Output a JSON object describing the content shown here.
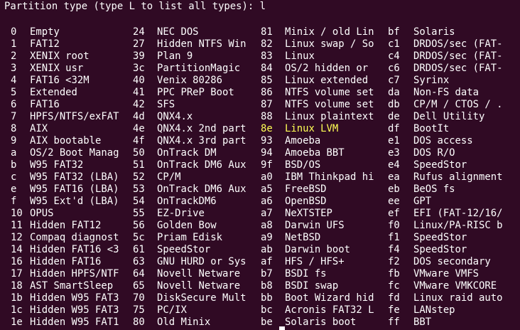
{
  "terminal": {
    "prompt": "Partition type (type L to list all types): l",
    "highlight_color": "#ffff55",
    "background_color": "#300a24",
    "text_color": "#ffffff",
    "rows": [
      [
        [
          "0",
          "Empty"
        ],
        [
          "24",
          "NEC DOS"
        ],
        [
          "81",
          "Minix / old Lin"
        ],
        [
          "bf",
          "Solaris"
        ]
      ],
      [
        [
          "1",
          "FAT12"
        ],
        [
          "27",
          "Hidden NTFS Win"
        ],
        [
          "82",
          "Linux swap / So"
        ],
        [
          "c1",
          "DRDOS/sec (FAT-"
        ]
      ],
      [
        [
          "2",
          "XENIX root"
        ],
        [
          "39",
          "Plan 9"
        ],
        [
          "83",
          "Linux"
        ],
        [
          "c4",
          "DRDOS/sec (FAT-"
        ]
      ],
      [
        [
          "3",
          "XENIX usr"
        ],
        [
          "3c",
          "PartitionMagic"
        ],
        [
          "84",
          "OS/2 hidden or"
        ],
        [
          "c6",
          "DRDOS/sec (FAT-"
        ]
      ],
      [
        [
          "4",
          "FAT16 <32M"
        ],
        [
          "40",
          "Venix 80286"
        ],
        [
          "85",
          "Linux extended"
        ],
        [
          "c7",
          "Syrinx"
        ]
      ],
      [
        [
          "5",
          "Extended"
        ],
        [
          "41",
          "PPC PReP Boot"
        ],
        [
          "86",
          "NTFS volume set"
        ],
        [
          "da",
          "Non-FS data"
        ]
      ],
      [
        [
          "6",
          "FAT16"
        ],
        [
          "42",
          "SFS"
        ],
        [
          "87",
          "NTFS volume set"
        ],
        [
          "db",
          "CP/M / CTOS / ."
        ]
      ],
      [
        [
          "7",
          "HPFS/NTFS/exFAT"
        ],
        [
          "4d",
          "QNX4.x"
        ],
        [
          "88",
          "Linux plaintext"
        ],
        [
          "de",
          "Dell Utility"
        ]
      ],
      [
        [
          "8",
          "AIX"
        ],
        [
          "4e",
          "QNX4.x 2nd part"
        ],
        [
          "8e",
          "Linux LVM"
        ],
        [
          "df",
          "BootIt"
        ]
      ],
      [
        [
          "9",
          "AIX bootable"
        ],
        [
          "4f",
          "QNX4.x 3rd part"
        ],
        [
          "93",
          "Amoeba"
        ],
        [
          "e1",
          "DOS access"
        ]
      ],
      [
        [
          "a",
          "OS/2 Boot Manag"
        ],
        [
          "50",
          "OnTrack DM"
        ],
        [
          "94",
          "Amoeba BBT"
        ],
        [
          "e3",
          "DOS R/O"
        ]
      ],
      [
        [
          "b",
          "W95 FAT32"
        ],
        [
          "51",
          "OnTrack DM6 Aux"
        ],
        [
          "9f",
          "BSD/OS"
        ],
        [
          "e4",
          "SpeedStor"
        ]
      ],
      [
        [
          "c",
          "W95 FAT32 (LBA)"
        ],
        [
          "52",
          "CP/M"
        ],
        [
          "a0",
          "IBM Thinkpad hi"
        ],
        [
          "ea",
          "Rufus alignment"
        ]
      ],
      [
        [
          "e",
          "W95 FAT16 (LBA)"
        ],
        [
          "53",
          "OnTrack DM6 Aux"
        ],
        [
          "a5",
          "FreeBSD"
        ],
        [
          "eb",
          "BeOS fs"
        ]
      ],
      [
        [
          "f",
          "W95 Ext'd (LBA)"
        ],
        [
          "54",
          "OnTrackDM6"
        ],
        [
          "a6",
          "OpenBSD"
        ],
        [
          "ee",
          "GPT"
        ]
      ],
      [
        [
          "10",
          "OPUS"
        ],
        [
          "55",
          "EZ-Drive"
        ],
        [
          "a7",
          "NeXTSTEP"
        ],
        [
          "ef",
          "EFI (FAT-12/16/"
        ]
      ],
      [
        [
          "11",
          "Hidden FAT12"
        ],
        [
          "56",
          "Golden Bow"
        ],
        [
          "a8",
          "Darwin UFS"
        ],
        [
          "f0",
          "Linux/PA-RISC b"
        ]
      ],
      [
        [
          "12",
          "Compaq diagnost"
        ],
        [
          "5c",
          "Priam Edisk"
        ],
        [
          "a9",
          "NetBSD"
        ],
        [
          "f1",
          "SpeedStor"
        ]
      ],
      [
        [
          "14",
          "Hidden FAT16 <3"
        ],
        [
          "61",
          "SpeedStor"
        ],
        [
          "ab",
          "Darwin boot"
        ],
        [
          "f4",
          "SpeedStor"
        ]
      ],
      [
        [
          "16",
          "Hidden FAT16"
        ],
        [
          "63",
          "GNU HURD or Sys"
        ],
        [
          "af",
          "HFS / HFS+"
        ],
        [
          "f2",
          "DOS secondary"
        ]
      ],
      [
        [
          "17",
          "Hidden HPFS/NTF"
        ],
        [
          "64",
          "Novell Netware"
        ],
        [
          "b7",
          "BSDI fs"
        ],
        [
          "fb",
          "VMware VMFS"
        ]
      ],
      [
        [
          "18",
          "AST SmartSleep"
        ],
        [
          "65",
          "Novell Netware"
        ],
        [
          "b8",
          "BSDI swap"
        ],
        [
          "fc",
          "VMware VMKCORE"
        ]
      ],
      [
        [
          "1b",
          "Hidden W95 FAT3"
        ],
        [
          "70",
          "DiskSecure Mult"
        ],
        [
          "bb",
          "Boot Wizard hid"
        ],
        [
          "fd",
          "Linux raid auto"
        ]
      ],
      [
        [
          "1c",
          "Hidden W95 FAT3"
        ],
        [
          "75",
          "PC/IX"
        ],
        [
          "bc",
          "Acronis FAT32 L"
        ],
        [
          "fe",
          "LANstep"
        ]
      ],
      [
        [
          "1e",
          "Hidden W95 FAT1"
        ],
        [
          "80",
          "Old Minix"
        ],
        [
          "be",
          "Solaris boot"
        ],
        [
          "ff",
          "BBT"
        ]
      ]
    ],
    "highlighted_row": 8,
    "highlighted_col": 2
  }
}
